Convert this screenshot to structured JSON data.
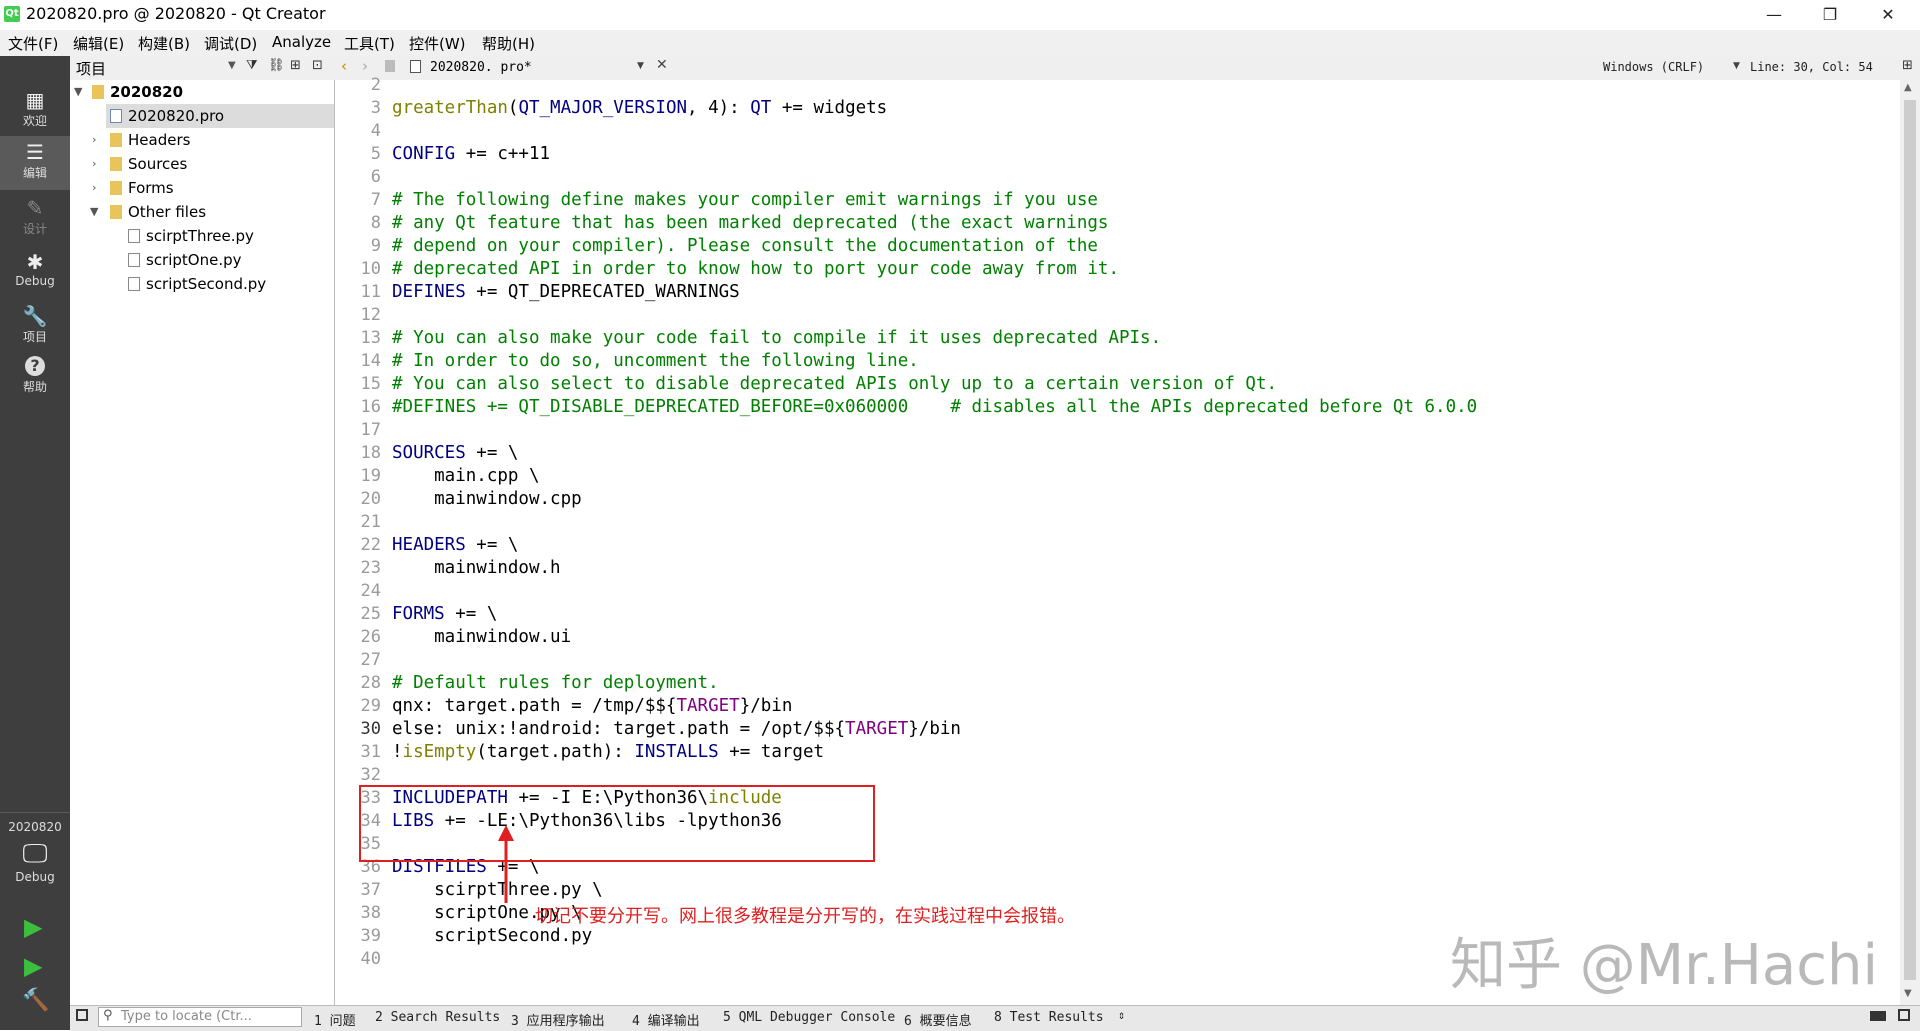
{
  "window": {
    "title": "2020820.pro @ 2020820 - Qt Creator",
    "app_icon": "Qt",
    "minimize": "—",
    "maximize": "❐",
    "close": "✕"
  },
  "menubar": [
    "文件(F)",
    "编辑(E)",
    "构建(B)",
    "调试(D)",
    "Analyze",
    "工具(T)",
    "控件(W)",
    "帮助(H)"
  ],
  "modes": [
    {
      "label": "欢迎",
      "icon": "grid-icon",
      "glyph": "▦"
    },
    {
      "label": "编辑",
      "icon": "edit-icon",
      "glyph": "☰"
    },
    {
      "label": "设计",
      "icon": "design-icon",
      "glyph": "✎"
    },
    {
      "label": "Debug",
      "icon": "bug-icon",
      "glyph": "✱"
    },
    {
      "label": "项目",
      "icon": "wrench-icon",
      "glyph": "🔧"
    },
    {
      "label": "帮助",
      "icon": "help-icon",
      "glyph": "?"
    }
  ],
  "target": {
    "project": "2020820",
    "config": "Debug",
    "monitor_glyph": "🖵"
  },
  "run_buttons": {
    "run": "▶",
    "debug_run": "▶",
    "build": "🔨"
  },
  "project_pane": {
    "title": "项目",
    "root": "2020820",
    "items": [
      {
        "label": "2020820.pro",
        "type": "pro"
      },
      {
        "label": "Headers",
        "type": "folder"
      },
      {
        "label": "Sources",
        "type": "folder"
      },
      {
        "label": "Forms",
        "type": "folder"
      },
      {
        "label": "Other files",
        "type": "folder"
      },
      {
        "label": "scirptThree.py",
        "type": "file"
      },
      {
        "label": "scriptOne.py",
        "type": "file"
      },
      {
        "label": "scriptSecond.py",
        "type": "file"
      }
    ]
  },
  "editor": {
    "file_tab": "2020820. pro*",
    "line_ending": "Windows (CRLF)",
    "cursor": "Line: 30, Col: 54",
    "current_line": 30,
    "lines": [
      {
        "n": "2",
        "segs": []
      },
      {
        "n": "3",
        "segs": [
          [
            "fn",
            "greaterThan"
          ],
          [
            "",
            "("
          ],
          [
            "kw",
            "QT_MAJOR_VERSION"
          ],
          [
            "",
            ", 4): "
          ],
          [
            "kw",
            "QT"
          ],
          [
            "",
            " += widgets"
          ]
        ]
      },
      {
        "n": "4",
        "segs": []
      },
      {
        "n": "5",
        "segs": [
          [
            "kw",
            "CONFIG"
          ],
          [
            "",
            " += c++11"
          ]
        ]
      },
      {
        "n": "6",
        "segs": []
      },
      {
        "n": "7",
        "segs": [
          [
            "cm",
            "# The following define makes your compiler emit warnings if you use"
          ]
        ]
      },
      {
        "n": "8",
        "segs": [
          [
            "cm",
            "# any Qt feature that has been marked deprecated (the exact warnings"
          ]
        ]
      },
      {
        "n": "9",
        "segs": [
          [
            "cm",
            "# depend on your compiler). Please consult the documentation of the"
          ]
        ]
      },
      {
        "n": "10",
        "segs": [
          [
            "cm",
            "# deprecated API in order to know how to port your code away from it."
          ]
        ]
      },
      {
        "n": "11",
        "segs": [
          [
            "kw",
            "DEFINES"
          ],
          [
            "",
            " += QT_DEPRECATED_WARNINGS"
          ]
        ]
      },
      {
        "n": "12",
        "segs": []
      },
      {
        "n": "13",
        "segs": [
          [
            "cm",
            "# You can also make your code fail to compile if it uses deprecated APIs."
          ]
        ]
      },
      {
        "n": "14",
        "segs": [
          [
            "cm",
            "# In order to do so, uncomment the following line."
          ]
        ]
      },
      {
        "n": "15",
        "segs": [
          [
            "cm",
            "# You can also select to disable deprecated APIs only up to a certain version of Qt."
          ]
        ]
      },
      {
        "n": "16",
        "segs": [
          [
            "cm",
            "#DEFINES += QT_DISABLE_DEPRECATED_BEFORE=0x060000    # disables all the APIs deprecated before Qt 6.0.0"
          ]
        ]
      },
      {
        "n": "17",
        "segs": []
      },
      {
        "n": "18",
        "segs": [
          [
            "kw",
            "SOURCES"
          ],
          [
            "",
            " += \\"
          ]
        ]
      },
      {
        "n": "19",
        "segs": [
          [
            "",
            "    main.cpp \\"
          ]
        ]
      },
      {
        "n": "20",
        "segs": [
          [
            "",
            "    mainwindow.cpp"
          ]
        ]
      },
      {
        "n": "21",
        "segs": []
      },
      {
        "n": "22",
        "segs": [
          [
            "kw",
            "HEADERS"
          ],
          [
            "",
            " += \\"
          ]
        ]
      },
      {
        "n": "23",
        "segs": [
          [
            "",
            "    mainwindow.h"
          ]
        ]
      },
      {
        "n": "24",
        "segs": []
      },
      {
        "n": "25",
        "segs": [
          [
            "kw",
            "FORMS"
          ],
          [
            "",
            " += \\"
          ]
        ]
      },
      {
        "n": "26",
        "segs": [
          [
            "",
            "    mainwindow.ui"
          ]
        ]
      },
      {
        "n": "27",
        "segs": []
      },
      {
        "n": "28",
        "segs": [
          [
            "cm",
            "# Default rules for deployment."
          ]
        ]
      },
      {
        "n": "29",
        "segs": [
          [
            "",
            "qnx: target.path = /tmp/$${"
          ],
          [
            "var",
            "TARGET"
          ],
          [
            "",
            "}/bin"
          ]
        ]
      },
      {
        "n": "30",
        "segs": [
          [
            "",
            "else: unix:!android: target.path = /opt/$${"
          ],
          [
            "var",
            "TARGET"
          ],
          [
            "",
            "}/bin"
          ]
        ]
      },
      {
        "n": "31",
        "segs": [
          [
            "",
            "!"
          ],
          [
            "fn",
            "isEmpty"
          ],
          [
            "",
            "(target.path): "
          ],
          [
            "kw",
            "INSTALLS"
          ],
          [
            "",
            " += target"
          ]
        ]
      },
      {
        "n": "32",
        "segs": []
      },
      {
        "n": "33",
        "segs": [
          [
            "kw",
            "INCLUDEPATH"
          ],
          [
            "",
            " += -I E:\\Python36\\"
          ],
          [
            "fn",
            "include"
          ]
        ]
      },
      {
        "n": "34",
        "segs": [
          [
            "kw",
            "LIBS"
          ],
          [
            "",
            " += -LE:\\Python36\\libs -lpython36"
          ]
        ]
      },
      {
        "n": "35",
        "segs": []
      },
      {
        "n": "36",
        "segs": [
          [
            "kw",
            "DISTFILES"
          ],
          [
            "",
            " += \\"
          ]
        ]
      },
      {
        "n": "37",
        "segs": [
          [
            "",
            "    scirptThree.py \\"
          ]
        ]
      },
      {
        "n": "38",
        "segs": [
          [
            "",
            "    scriptOne.py \\"
          ]
        ]
      },
      {
        "n": "39",
        "segs": [
          [
            "",
            "    scriptSecond.py"
          ]
        ]
      },
      {
        "n": "40",
        "segs": []
      }
    ]
  },
  "annotation": {
    "note": "切记不要分开写。网上很多教程是分开写的，在实践过程中会报错。",
    "watermark": "知乎 @Mr.Hachi",
    "color": "#e02020"
  },
  "statusbar": {
    "locate_placeholder": "Type to locate (Ctr...",
    "panes": [
      "1 问题",
      "2 Search Results",
      "3 应用程序输出",
      "4 编译输出",
      "5 QML Debugger Console",
      "6 概要信息",
      "8 Test Results"
    ]
  }
}
